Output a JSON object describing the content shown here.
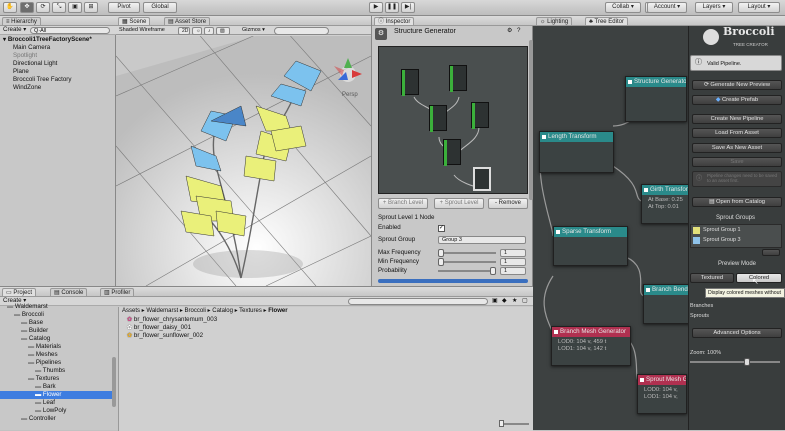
{
  "toolbar": {
    "pivot": "Pivot",
    "global": "Global",
    "collab": "Collab ▾",
    "account": "Account ▾",
    "layers": "Layers ▾",
    "layout": "Layout ▾"
  },
  "hierarchy": {
    "tab": "Hierarchy",
    "create": "Create ▾",
    "search": "Q·All",
    "items": [
      {
        "label": "Broccoli1TreeFactoryScene*",
        "indent": 0,
        "bold": true
      },
      {
        "label": "Main Camera",
        "indent": 1
      },
      {
        "label": "Spotlight",
        "indent": 1,
        "dim": true
      },
      {
        "label": "Directional Light",
        "indent": 1
      },
      {
        "label": "Plane",
        "indent": 1
      },
      {
        "label": "Broccoli Tree Factory",
        "indent": 1
      },
      {
        "label": "WindZone",
        "indent": 1
      }
    ]
  },
  "scene": {
    "tab_scene": "Scene",
    "tab_store": "Asset Store",
    "shading": "Shaded Wireframe",
    "mode2d": "2D",
    "gizmos": "Gizmos ▾",
    "persp": "Persp"
  },
  "inspector": {
    "tab": "Inspector",
    "title": "Structure Generator",
    "add_level": "+ Branch Level",
    "sprout_level": "+ Sprout Level",
    "remove": "- Remove",
    "node_title": "Sprout Level 1 Node",
    "enabled_label": "Enabled",
    "sprout_group_label": "Sprout Group",
    "sprout_group_value": "Group 3",
    "max_freq_label": "Max Frequency",
    "max_freq": "1",
    "min_freq_label": "Min Frequency",
    "min_freq": "1",
    "prob_label": "Probability",
    "prob": "1"
  },
  "tree_editor": {
    "tab_lighting": "Lighting",
    "tab_tree": "Tree Editor",
    "nodes": [
      {
        "title": "Structure Generator",
        "color": "#2a8a8a"
      },
      {
        "title": "Length Transform",
        "color": "#2a8a8a"
      },
      {
        "title": "Girth Transform",
        "color": "#2a8a8a",
        "lines": [
          "At Base: 0.25",
          "At Top: 0.01"
        ]
      },
      {
        "title": "Sparse Transform",
        "color": "#2a8a8a"
      },
      {
        "title": "Branch Bender",
        "color": "#2a8a8a"
      },
      {
        "title": "Branch Mesh Generator",
        "color": "#b03050",
        "lines": [
          "LOD0: 104 v, 459 t",
          "LOD1: 104 v, 142 t"
        ]
      },
      {
        "title": "Sprout Mesh Generator",
        "color": "#b03050",
        "lines": [
          "LOD0: 104 v,",
          "LOD1: 104 v,"
        ]
      }
    ]
  },
  "broccoli": {
    "logo": "Broccoli",
    "subtitle": "TREE CREATOR",
    "valid": "Valid Pipeline.",
    "btn_preview": "Generate New Preview",
    "btn_prefab": "Create Prefab",
    "btn_pipeline": "Create New Pipeline",
    "btn_load": "Load From Asset",
    "btn_save_as": "Save As New Asset",
    "btn_save": "Save",
    "unsaved": "Pipeline changes need to be saved to an asset first.",
    "btn_catalog": "Open from Catalog",
    "sprout_groups": "Sprout Groups",
    "groups": [
      {
        "label": "Sprout Group 1",
        "color": "#e2e07a"
      },
      {
        "label": "Sprout Group 3",
        "color": "#8fc3ea"
      }
    ],
    "preview_mode": "Preview Mode",
    "textured": "Textured",
    "colored": "Colored",
    "tooltip": "Display colored meshes without",
    "branches": "Branches",
    "sprouts": "Sprouts",
    "advanced": "Advanced Options",
    "zoom": "Zoom: 100%"
  },
  "project": {
    "tab_project": "Project",
    "tab_console": "Console",
    "tab_profiler": "Profiler",
    "create": "Create ▾",
    "tree": [
      {
        "label": "Waldemarst",
        "indent": 1
      },
      {
        "label": "Broccoli",
        "indent": 2
      },
      {
        "label": "Base",
        "indent": 3
      },
      {
        "label": "Builder",
        "indent": 3
      },
      {
        "label": "Catalog",
        "indent": 3
      },
      {
        "label": "Materials",
        "indent": 4
      },
      {
        "label": "Meshes",
        "indent": 4
      },
      {
        "label": "Pipelines",
        "indent": 4
      },
      {
        "label": "Thumbs",
        "indent": 5
      },
      {
        "label": "Textures",
        "indent": 4
      },
      {
        "label": "Bark",
        "indent": 5
      },
      {
        "label": "Flower",
        "indent": 5,
        "selected": true
      },
      {
        "label": "Leaf",
        "indent": 5
      },
      {
        "label": "LowPoly",
        "indent": 5
      },
      {
        "label": "Controller",
        "indent": 3
      }
    ],
    "breadcrumb": [
      "Assets",
      "Waldemarst",
      "Broccoli",
      "Catalog",
      "Textures",
      "Flower"
    ],
    "files": [
      {
        "label": "br_flower_chrysantemum_003",
        "color": "#d84a8a"
      },
      {
        "label": "br_flower_daisy_001",
        "color": "#ffffff"
      },
      {
        "label": "br_flower_sunflower_002",
        "color": "#f0b020"
      }
    ]
  }
}
